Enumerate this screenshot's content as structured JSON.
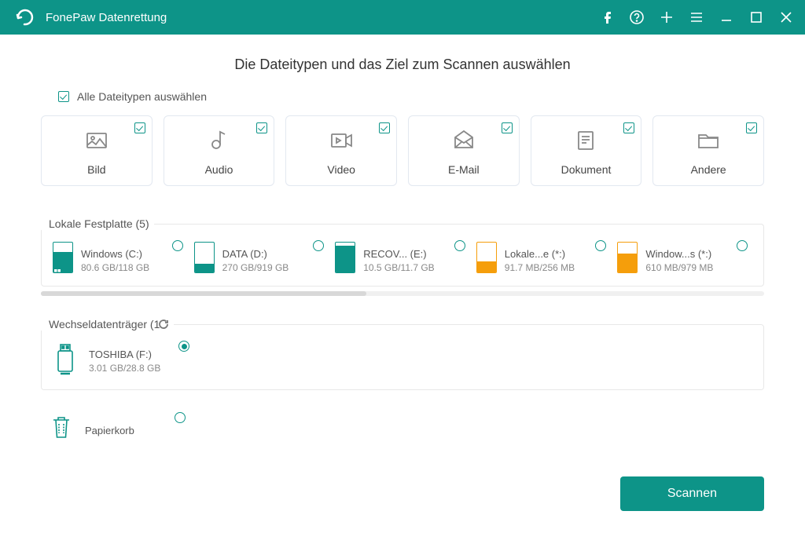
{
  "titlebar": {
    "title": "FonePaw Datenrettung"
  },
  "main": {
    "heading": "Die Dateitypen und das Ziel zum Scannen auswählen",
    "select_all_label": "Alle Dateitypen auswählen"
  },
  "types": [
    {
      "id": "image",
      "label": "Bild",
      "checked": true
    },
    {
      "id": "audio",
      "label": "Audio",
      "checked": true
    },
    {
      "id": "video",
      "label": "Video",
      "checked": true
    },
    {
      "id": "email",
      "label": "E-Mail",
      "checked": true
    },
    {
      "id": "document",
      "label": "Dokument",
      "checked": true
    },
    {
      "id": "other",
      "label": "Andere",
      "checked": true
    }
  ],
  "sections": {
    "local": {
      "title": "Lokale Festplatte (5)"
    },
    "removable": {
      "title": "Wechseldatenträger (1",
      "refresh_suffix": ")"
    },
    "recycle": {
      "label": "Papierkorb"
    }
  },
  "local_drives": [
    {
      "name": "Windows (C:)",
      "size": "80.6 GB/118 GB",
      "color": "teal",
      "fill_pct": 68,
      "os": true
    },
    {
      "name": "DATA (D:)",
      "size": "270 GB/919 GB",
      "color": "teal",
      "fill_pct": 29
    },
    {
      "name": "RECOV... (E:)",
      "size": "10.5 GB/11.7 GB",
      "color": "teal",
      "fill_pct": 90
    },
    {
      "name": "Lokale...e (*:)",
      "size": "91.7 MB/256 MB",
      "color": "orange",
      "fill_pct": 36
    },
    {
      "name": "Window...s (*:)",
      "size": "610 MB/979 MB",
      "color": "orange",
      "fill_pct": 62
    }
  ],
  "removable_drives": [
    {
      "name": "TOSHIBA (F:)",
      "size": "3.01 GB/28.8 GB",
      "selected": true
    }
  ],
  "footer": {
    "scan_label": "Scannen"
  }
}
